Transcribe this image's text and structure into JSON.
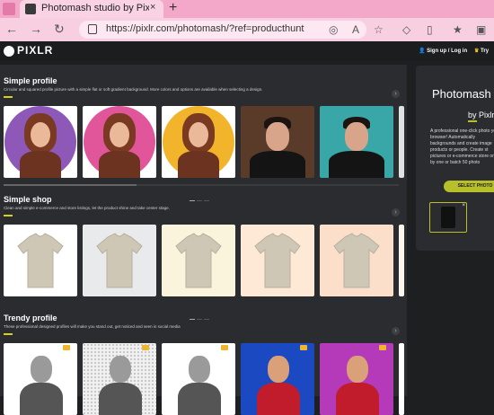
{
  "browser": {
    "tab_title": "Photomash studio by Pixlr : rem",
    "tab_close": "×",
    "new_tab": "+",
    "url": "https://pixlr.com/photomash/?ref=producthunt",
    "nav": {
      "back": "←",
      "forward": "→",
      "reload": "↻"
    }
  },
  "pixlr": {
    "logo": "PIXLR",
    "signup": "Sign up / Log in",
    "try": "Try"
  },
  "sections": [
    {
      "title": "Simple profile",
      "desc": "Circular and squared profile picture with a simple flat or soft gradient background. More colors and options are available when selecting a design.",
      "card_colors": [
        "#8e58b8",
        "#e1559a",
        "#f2b42b",
        "#5a3b2a",
        "#39a7a8",
        "#dfe2e3"
      ]
    },
    {
      "title": "Simple shop",
      "desc": "Clean and simple e-commerce and store listings, let the product shine and take center stage.",
      "card_colors": [
        "#ffffff",
        "#e8eaec",
        "#fbf4dc",
        "#fde9d6",
        "#fcdfcb",
        "#fbf7ec"
      ]
    },
    {
      "title": "Trendy profile",
      "desc": "These professional designed profiles will make you stand out, get noticed and seen in social media",
      "card_colors": [
        "#ffffff",
        "#f0f0f0",
        "#ffffff",
        "#1b49c2",
        "#b43ab9",
        "#ffffff"
      ]
    }
  ],
  "right_panel": {
    "title": "Photomash",
    "by": "by Pixlr",
    "desc": "A professional one-click photo your browser! Automatically backgrounds and create image products or people. Create st pictures or e-commerce store one by one or batch 50 photo",
    "button": "SELECT PHOTO",
    "close": "×"
  },
  "colors": {
    "accent": "#b7c028",
    "panel": "#2a2c2f",
    "background": "#1d1f21"
  }
}
